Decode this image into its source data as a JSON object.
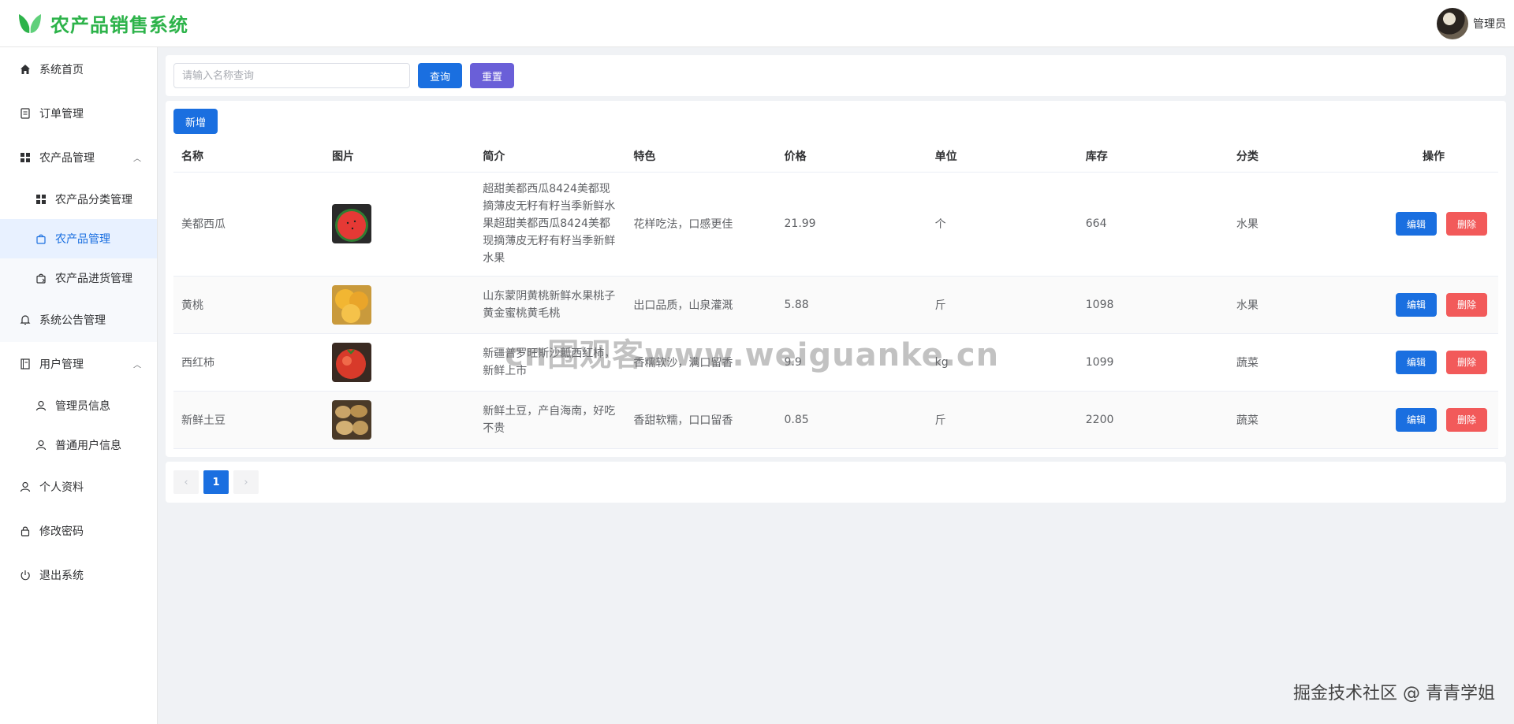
{
  "header": {
    "title": "农产品销售系统",
    "user": "管理员"
  },
  "sidebar": {
    "home": "系统首页",
    "orders": "订单管理",
    "products_group": "农产品管理",
    "category": "农产品分类管理",
    "products": "农产品管理",
    "purchase": "农产品进货管理",
    "notice": "系统公告管理",
    "users_group": "用户管理",
    "admin_info": "管理员信息",
    "normal_user_info": "普通用户信息",
    "profile": "个人资料",
    "password": "修改密码",
    "logout": "退出系统"
  },
  "search": {
    "placeholder": "请输入名称查询",
    "query": "查询",
    "reset": "重置"
  },
  "toolbar": {
    "add": "新增"
  },
  "table": {
    "headers": {
      "name": "名称",
      "image": "图片",
      "intro": "简介",
      "feature": "特色",
      "price": "价格",
      "unit": "单位",
      "stock": "库存",
      "category": "分类",
      "ops": "操作"
    },
    "edit_label": "编辑",
    "delete_label": "删除",
    "rows": [
      {
        "name": "美都西瓜",
        "intro": "超甜美都西瓜8424美都现摘薄皮无籽有籽当季新鲜水果超甜美都西瓜8424美都现摘薄皮无籽有籽当季新鲜水果",
        "feature": "花样吃法，口感更佳",
        "price": "21.99",
        "unit": "个",
        "stock": "664",
        "category": "水果"
      },
      {
        "name": "黄桃",
        "intro": "山东蒙阴黄桃新鲜水果桃子黄金蜜桃黄毛桃",
        "feature": "出口品质，山泉灌溉",
        "price": "5.88",
        "unit": "斤",
        "stock": "1098",
        "category": "水果"
      },
      {
        "name": "西红柿",
        "intro": "新疆普罗旺斯沙瓤西红柿，新鲜上市",
        "feature": "香糯软沙，满口留香",
        "price": "9.9",
        "unit": "kg",
        "stock": "1099",
        "category": "蔬菜"
      },
      {
        "name": "新鲜土豆",
        "intro": "新鲜土豆，产自海南，好吃不贵",
        "feature": "香甜软糯，口口留香",
        "price": "0.85",
        "unit": "斤",
        "stock": "2200",
        "category": "蔬菜"
      }
    ]
  },
  "pagination": {
    "prev": "‹",
    "current": "1",
    "next": "›"
  },
  "overlay": {
    "watermark": "cn围观客www.weiguanke.cn",
    "credit": "掘金技术社区 @ 青青学姐"
  },
  "icons": [
    "leaf-logo-icon",
    "home-icon",
    "document-icon",
    "grid-icon",
    "bag-icon",
    "bag-import-icon",
    "bell-icon",
    "ledger-icon",
    "user-icon",
    "lock-icon",
    "power-icon"
  ],
  "colors": {
    "brand": "#2db34a",
    "primary": "#1a6fe0",
    "purple": "#6a5fd8",
    "danger": "#f25a5a",
    "active_bg": "#e8f1ff"
  }
}
